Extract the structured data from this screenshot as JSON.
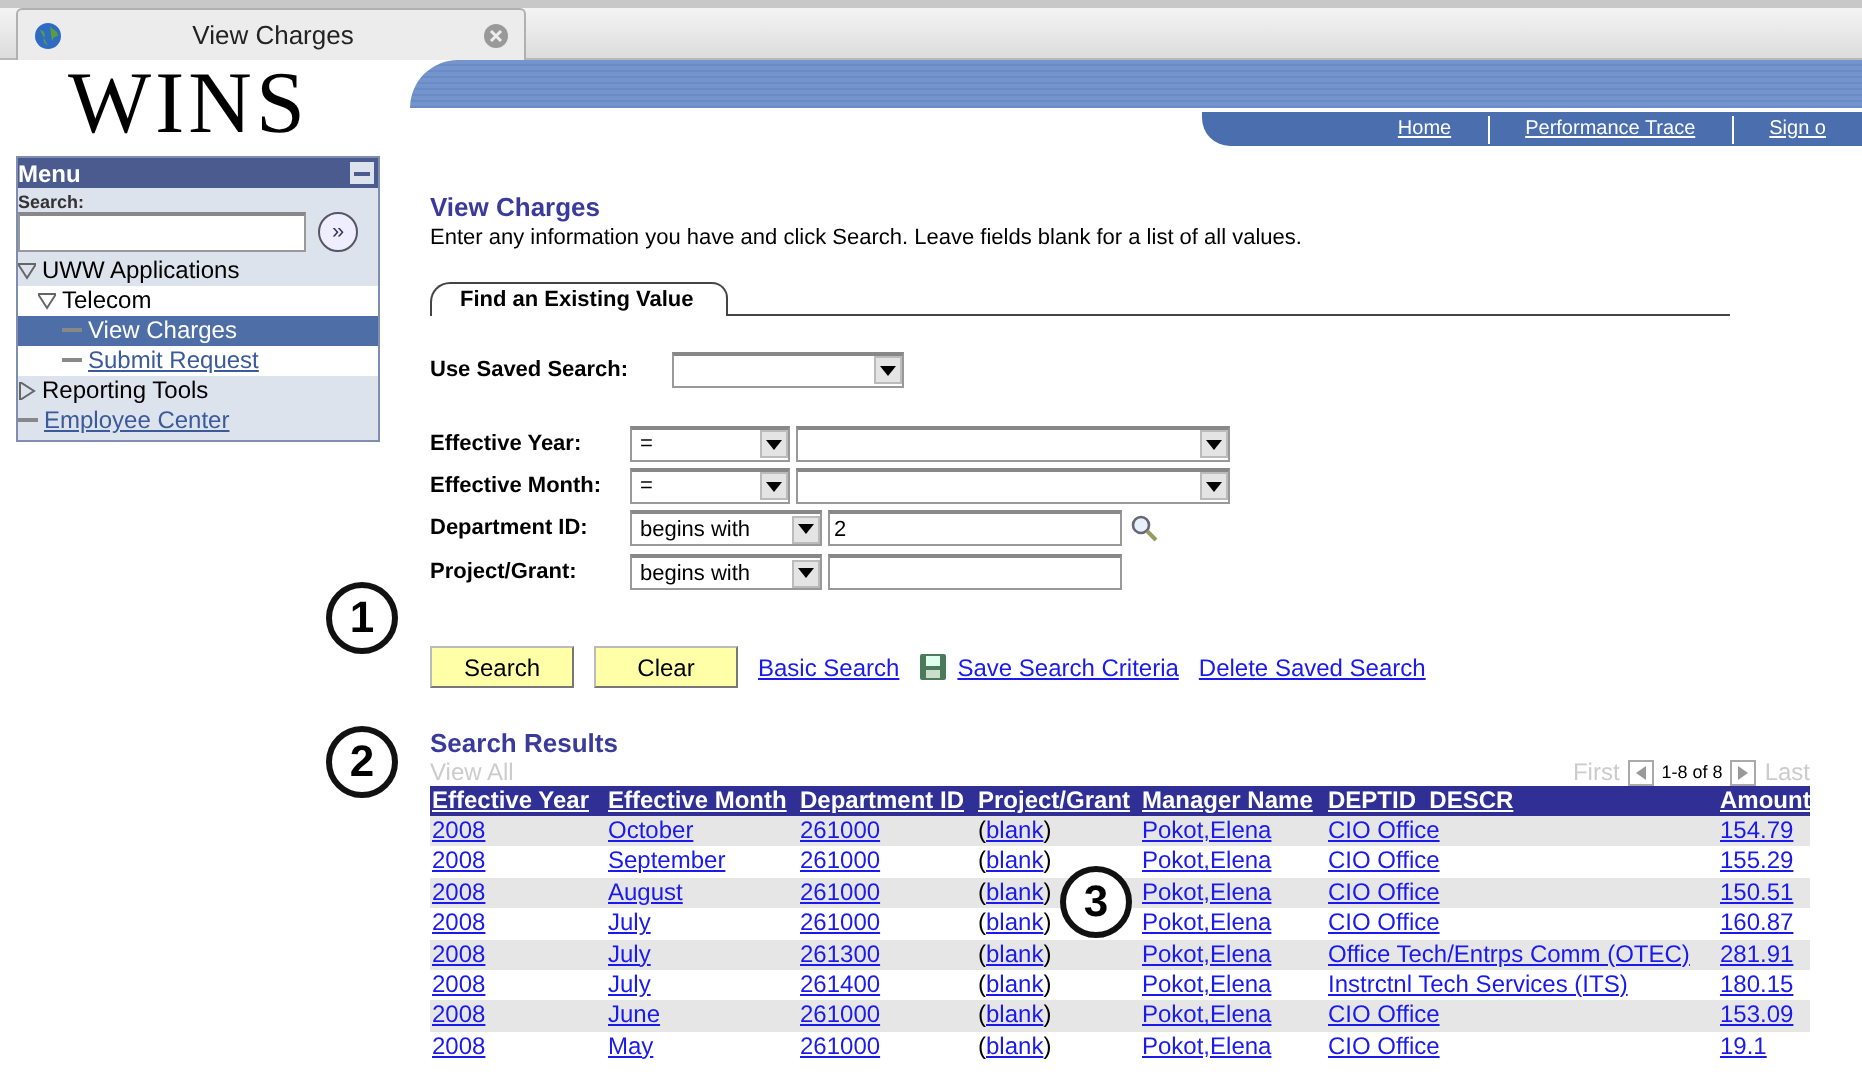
{
  "browser_tab": {
    "title": "View Charges"
  },
  "logo": "WINS",
  "nav_links": [
    "Home",
    "Performance Trace",
    "Sign o"
  ],
  "menu": {
    "title": "Menu",
    "search_label": "Search:",
    "go_label": "»",
    "items": [
      {
        "label": "UWW Applications",
        "kind": "folder",
        "expanded": true,
        "selected": false,
        "children": [
          {
            "label": "Telecom",
            "kind": "folder",
            "expanded": true,
            "selected": false,
            "children": [
              {
                "label": "View Charges",
                "kind": "page",
                "selected": true
              },
              {
                "label": "Submit Request",
                "kind": "page",
                "selected": false
              }
            ]
          }
        ]
      },
      {
        "label": "Reporting Tools",
        "kind": "folder",
        "expanded": false,
        "selected": false
      },
      {
        "label": "Employee Center",
        "kind": "page",
        "selected": false
      }
    ]
  },
  "page_title": "View Charges",
  "instructions": "Enter any information you have and click Search. Leave fields blank for a list of all values.",
  "tab": "Find an Existing Value",
  "saved_search": {
    "label": "Use Saved Search:"
  },
  "criteria": [
    {
      "label": "Effective Year:",
      "operator": "=",
      "kind": "select"
    },
    {
      "label": "Effective Month:",
      "operator": "=",
      "kind": "select"
    },
    {
      "label": "Department ID:",
      "operator": "begins with",
      "kind": "lookup",
      "value": "2"
    },
    {
      "label": "Project/Grant:",
      "operator": "begins with",
      "kind": "text"
    }
  ],
  "actions": [
    {
      "label": "Search",
      "kind": "button"
    },
    {
      "label": "Clear",
      "kind": "button"
    },
    {
      "label": "Basic Search",
      "kind": "link"
    },
    {
      "label": "Save Search Criteria",
      "kind": "save-link"
    },
    {
      "label": "Delete Saved Search",
      "kind": "link"
    }
  ],
  "results": {
    "title": "Search Results",
    "view_all": "View All",
    "first": "First",
    "range": "1-8 of 8",
    "last": "Last",
    "columns": [
      "Effective Year",
      "Effective Month",
      "Department ID",
      "Project/Grant",
      "Manager Name",
      "DEPTID_DESCR",
      "Amount"
    ],
    "rows": [
      [
        "2008",
        "October",
        "261000",
        {
          "before": "(",
          "link": "blank",
          "after": ")"
        },
        "Pokot,Elena",
        "CIO Office",
        "154.79"
      ],
      [
        "2008",
        "September",
        "261000",
        {
          "before": "(",
          "link": "blank",
          "after": ")"
        },
        "Pokot,Elena",
        "CIO Office",
        "155.29"
      ],
      [
        "2008",
        "August",
        "261000",
        {
          "before": "(",
          "link": "blank",
          "after": ")"
        },
        "Pokot,Elena",
        "CIO Office",
        "150.51"
      ],
      [
        "2008",
        "July",
        "261000",
        {
          "before": "(",
          "link": "blank",
          "after": ")"
        },
        "Pokot,Elena",
        "CIO Office",
        "160.87"
      ],
      [
        "2008",
        "July",
        "261300",
        {
          "before": "(",
          "link": "blank",
          "after": ")"
        },
        "Pokot,Elena",
        "Office Tech/Entrps Comm (OTEC)",
        "281.91"
      ],
      [
        "2008",
        "July",
        "261400",
        {
          "before": "(",
          "link": "blank",
          "after": ")"
        },
        "Pokot,Elena",
        "Instrctnl Tech Services (ITS)",
        "180.15"
      ],
      [
        "2008",
        "June",
        "261000",
        {
          "before": "(",
          "link": "blank",
          "after": ")"
        },
        "Pokot,Elena",
        "CIO Office",
        "153.09"
      ],
      [
        "2008",
        "May",
        "261000",
        {
          "before": "(",
          "link": "blank",
          "after": ")"
        },
        "Pokot,Elena",
        "CIO Office",
        "19.1"
      ]
    ]
  },
  "callouts": [
    "1",
    "2",
    "3"
  ]
}
